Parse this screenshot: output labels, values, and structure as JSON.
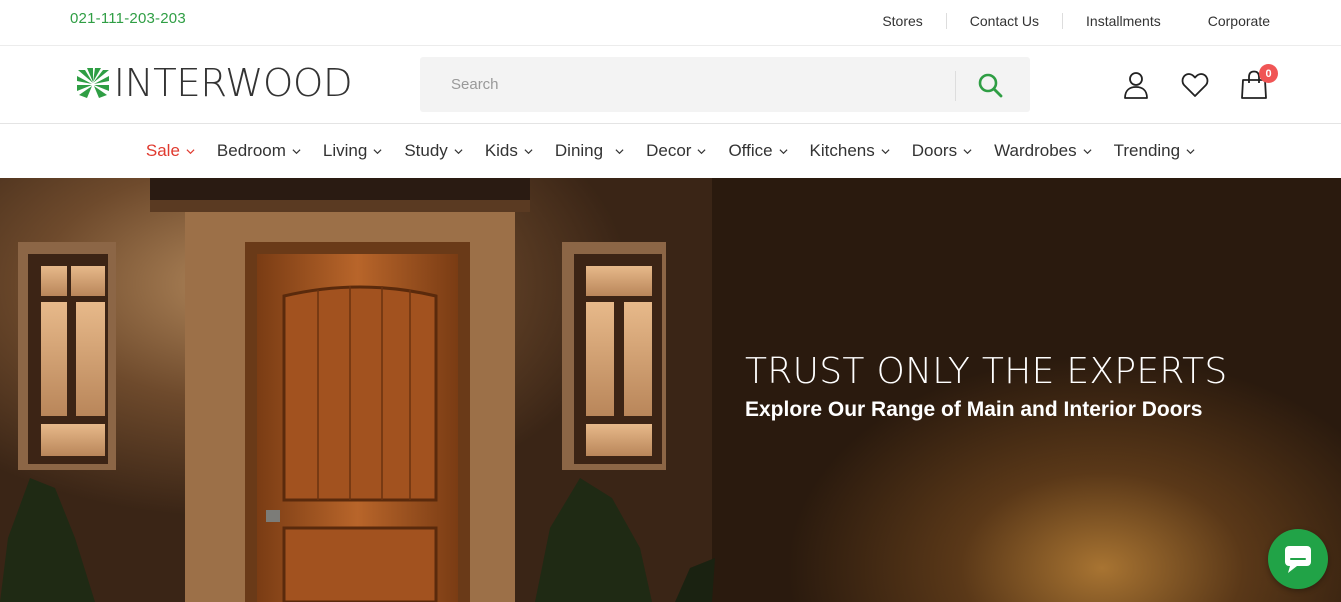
{
  "topbar": {
    "phone": "021-111-203-203",
    "links": [
      "Stores",
      "Contact Us",
      "Installments",
      "Corporate"
    ]
  },
  "header": {
    "logo_text": "INTERWOOD",
    "search_placeholder": "Search",
    "cart_count": "0"
  },
  "nav": {
    "items": [
      "Sale",
      "Bedroom",
      "Living",
      "Study",
      "Kids",
      "Dining",
      "Decor",
      "Office",
      "Kitchens",
      "Doors",
      "Wardrobes",
      "Trending"
    ]
  },
  "hero": {
    "title": "TRUST ONLY THE EXPERTS",
    "subtitle": "Explore Our Range of Main and Interior Doors"
  },
  "colors": {
    "brand_green": "#2f9e44",
    "sale_red": "#e03a2f",
    "badge_red": "#f05555",
    "chat_green": "#21a347"
  },
  "icons": [
    "search-icon",
    "user-icon",
    "heart-icon",
    "cart-icon",
    "chevron-down-icon",
    "chat-icon",
    "interwood-leaf-logo"
  ]
}
